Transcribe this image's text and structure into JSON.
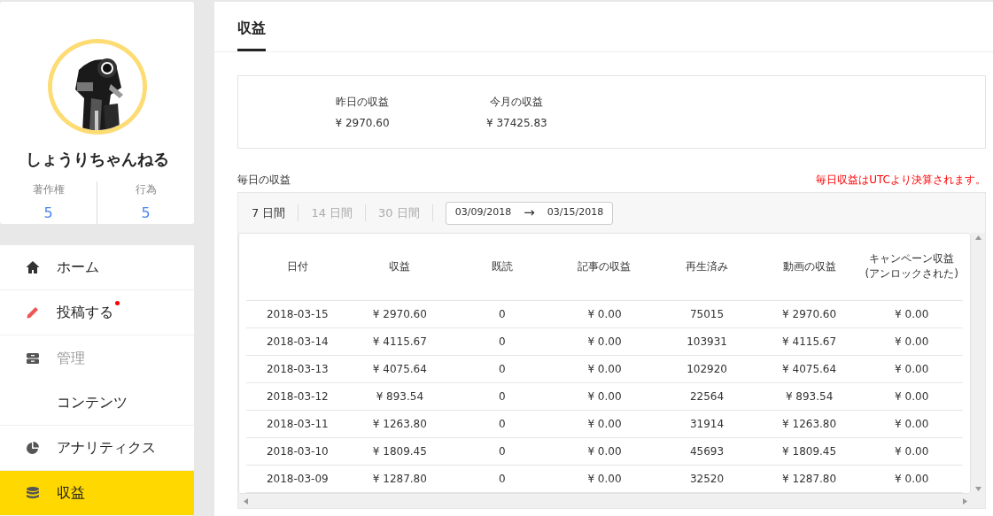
{
  "profile": {
    "name": "しょうりちゃんねる",
    "stats": [
      {
        "label": "著作権",
        "value": "5"
      },
      {
        "label": "行為",
        "value": "5"
      }
    ]
  },
  "menu": [
    {
      "label": "ホーム",
      "kind": "item",
      "selected": false,
      "notification": false
    },
    {
      "label": "投稿する",
      "kind": "item",
      "selected": false,
      "notification": true
    },
    {
      "label": "管理",
      "kind": "group",
      "selected": false,
      "notification": false
    },
    {
      "label": "コンテンツ",
      "kind": "sub",
      "selected": false,
      "notification": false
    },
    {
      "label": "アナリティクス",
      "kind": "item",
      "selected": false,
      "notification": false
    },
    {
      "label": "収益",
      "kind": "item",
      "selected": true,
      "notification": false
    }
  ],
  "page_title": "収益",
  "summary": [
    {
      "label": "昨日の収益",
      "value": "¥ 2970.60"
    },
    {
      "label": "今月の収益",
      "value": "¥ 37425.83"
    }
  ],
  "daily": {
    "title": "毎日の収益",
    "note": "毎日収益はUTCより決算されます。",
    "periods": [
      {
        "label": "7 日間",
        "selected": true
      },
      {
        "label": "14 日間",
        "selected": false
      },
      {
        "label": "30 日間",
        "selected": false
      }
    ],
    "date_from": "03/09/2018",
    "arrow": "→",
    "date_to": "03/15/2018"
  },
  "table": {
    "columns": [
      "日付",
      "収益",
      "既読",
      "記事の収益",
      "再生済み",
      "動画の収益",
      "キャンペーン収益(アンロックされた)"
    ],
    "rows": [
      [
        "2018-03-15",
        "¥ 2970.60",
        "0",
        "¥ 0.00",
        "75015",
        "¥ 2970.60",
        "¥ 0.00"
      ],
      [
        "2018-03-14",
        "¥ 4115.67",
        "0",
        "¥ 0.00",
        "103931",
        "¥ 4115.67",
        "¥ 0.00"
      ],
      [
        "2018-03-13",
        "¥ 4075.64",
        "0",
        "¥ 0.00",
        "102920",
        "¥ 4075.64",
        "¥ 0.00"
      ],
      [
        "2018-03-12",
        "¥ 893.54",
        "0",
        "¥ 0.00",
        "22564",
        "¥ 893.54",
        "¥ 0.00"
      ],
      [
        "2018-03-11",
        "¥ 1263.80",
        "0",
        "¥ 0.00",
        "31914",
        "¥ 1263.80",
        "¥ 0.00"
      ],
      [
        "2018-03-10",
        "¥ 1809.45",
        "0",
        "¥ 0.00",
        "45693",
        "¥ 1809.45",
        "¥ 0.00"
      ],
      [
        "2018-03-09",
        "¥ 1287.80",
        "0",
        "¥ 0.00",
        "32520",
        "¥ 1287.80",
        "¥ 0.00"
      ]
    ]
  }
}
